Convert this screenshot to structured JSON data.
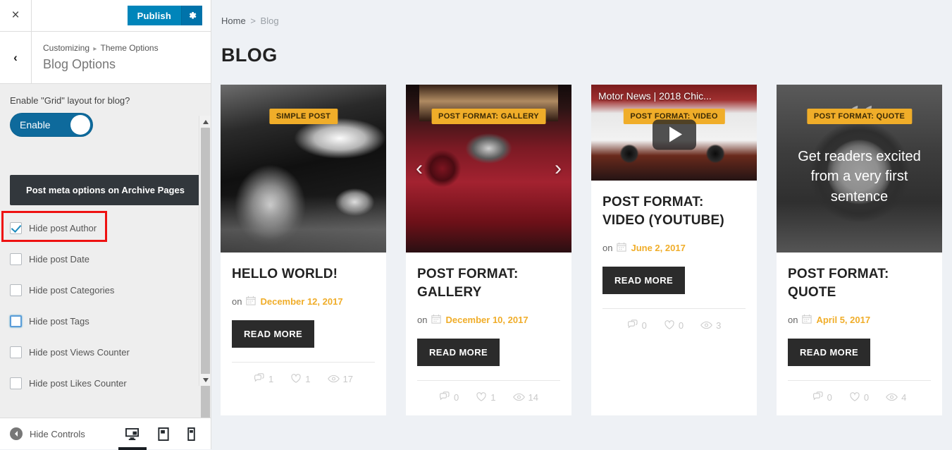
{
  "customizer": {
    "close_label": "×",
    "publish_label": "Publish",
    "gear_icon": "gear-icon",
    "back_label": "‹",
    "breadcrumb": {
      "root": "Customizing",
      "separator": "▸",
      "section": "Theme Options"
    },
    "panel_title": "Blog Options",
    "grid_control": {
      "label": "Enable \"Grid\" layout for blog?",
      "toggle_text": "Enable",
      "toggle_on": true
    },
    "meta_section_header": "Post meta options on Archive Pages",
    "checkboxes": [
      {
        "label": "Hide post Author",
        "checked": true,
        "highlighted": true,
        "focused": false
      },
      {
        "label": "Hide post Date",
        "checked": false,
        "highlighted": false,
        "focused": false
      },
      {
        "label": "Hide post Categories",
        "checked": false,
        "highlighted": false,
        "focused": false
      },
      {
        "label": "Hide post Tags",
        "checked": false,
        "highlighted": false,
        "focused": true
      },
      {
        "label": "Hide post Views Counter",
        "checked": false,
        "highlighted": false,
        "focused": false
      },
      {
        "label": "Hide post Likes Counter",
        "checked": false,
        "highlighted": false,
        "focused": false
      }
    ],
    "footer": {
      "hide_controls_label": "Hide Controls",
      "devices": [
        {
          "name": "desktop",
          "active": true
        },
        {
          "name": "tablet",
          "active": false
        },
        {
          "name": "mobile",
          "active": false
        }
      ]
    }
  },
  "preview": {
    "breadcrumb": {
      "home": "Home",
      "separator": ">",
      "current": "Blog"
    },
    "page_title": "BLOG",
    "meta_prefix": "on",
    "read_more_label": "READ MORE",
    "posts": [
      {
        "badge": "SIMPLE POST",
        "title": "HELLO WORLD!",
        "date": "December 12, 2017",
        "comments": "1",
        "likes": "1",
        "views": "17",
        "format": "image"
      },
      {
        "badge": "POST FORMAT: GALLERY",
        "title": "POST FORMAT: GALLERY",
        "date": "December 10, 2017",
        "comments": "0",
        "likes": "1",
        "views": "14",
        "format": "gallery",
        "prev_arrow": "‹",
        "next_arrow": "›"
      },
      {
        "badge": "POST FORMAT: VIDEO",
        "title": "POST FORMAT: VIDEO (YOUTUBE)",
        "date": "June 2, 2017",
        "comments": "0",
        "likes": "0",
        "views": "3",
        "format": "video",
        "video_title": "Motor News | 2018 Chic..."
      },
      {
        "badge": "POST FORMAT: QUOTE",
        "title": "POST FORMAT: QUOTE",
        "date": "April 5, 2017",
        "comments": "0",
        "likes": "0",
        "views": "4",
        "format": "quote",
        "quote_text": "Get readers excited from a very first sentence",
        "quote_mark": "“"
      }
    ]
  },
  "colors": {
    "wp_blue": "#0085ba",
    "accent_orange": "#f0ad29",
    "dark_button": "#2b2b2b",
    "highlight_red": "#ee1111"
  }
}
